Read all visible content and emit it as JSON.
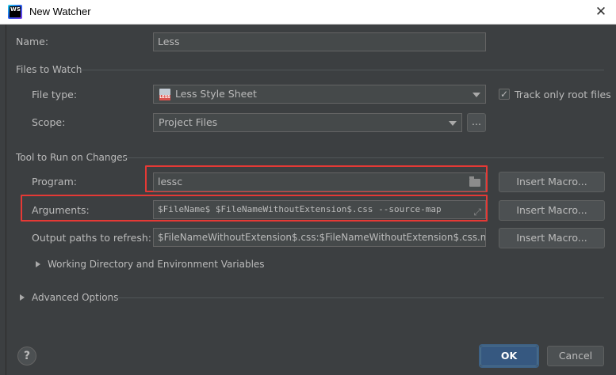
{
  "window": {
    "title": "New Watcher",
    "app_icon_text": "WS"
  },
  "name": {
    "label": "Name:",
    "value": "Less"
  },
  "files_to_watch": {
    "section_label": "Files to Watch",
    "file_type": {
      "label": "File type:",
      "value": "Less Style Sheet",
      "icon": "less-file-icon"
    },
    "track_only_root": {
      "label": "Track only root files",
      "checked": true
    },
    "scope": {
      "label": "Scope:",
      "value": "Project Files",
      "browse_label": "..."
    }
  },
  "tool": {
    "section_label": "Tool to Run on Changes",
    "program": {
      "label": "Program:",
      "value": "lessc",
      "icon": "folder-icon"
    },
    "arguments": {
      "label": "Arguments:",
      "value": "$FileName$ $FileNameWithoutExtension$.css --source-map",
      "icon": "expand-icon"
    },
    "output_paths": {
      "label": "Output paths to refresh:",
      "value": "$FileNameWithoutExtension$.css:$FileNameWithoutExtension$.css.map"
    },
    "insert_macro_label": "Insert Macro...",
    "working_dir_label": "Working Directory and Environment Variables"
  },
  "advanced": {
    "label": "Advanced Options"
  },
  "footer": {
    "help_label": "?",
    "ok_label": "OK",
    "cancel_label": "Cancel"
  },
  "colors": {
    "background": "#3c3f41",
    "field": "#45494a",
    "highlight_box": "#e53935",
    "ok_button": "#365880"
  }
}
